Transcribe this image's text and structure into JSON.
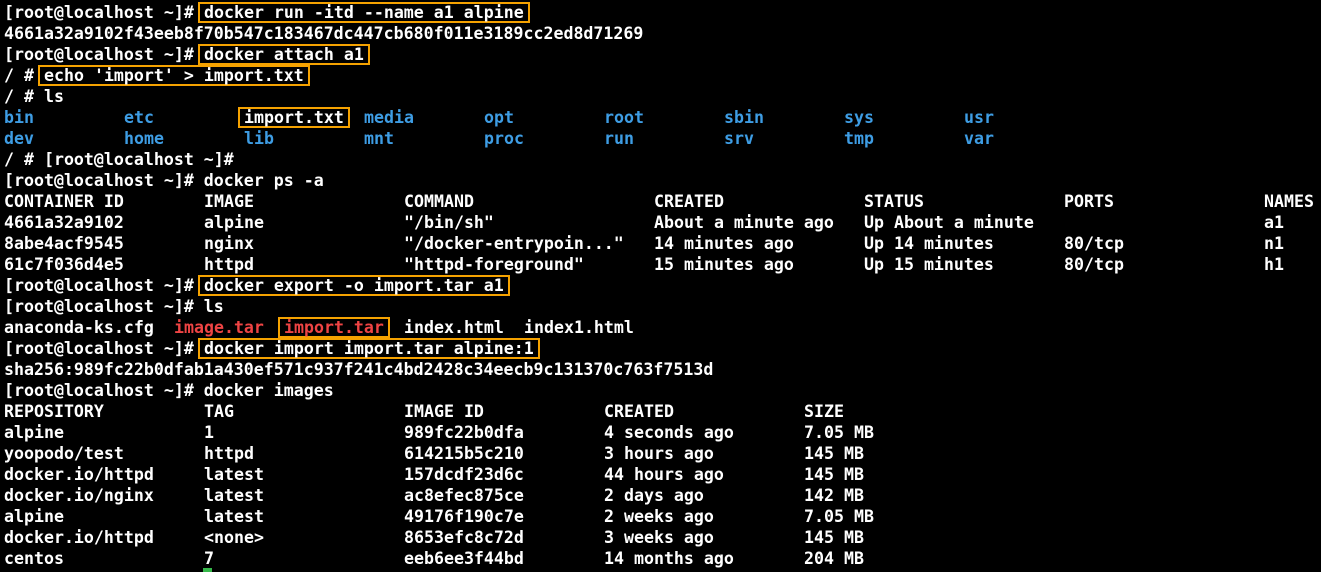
{
  "terminal": {
    "colors": {
      "background": "#000000",
      "text": "#ffffff",
      "directory": "#3e9de4",
      "archive": "#ef4444",
      "highlight_box": "#f5a200",
      "cursor": "#35b84a"
    },
    "lines": [
      {
        "name": "line-prompt-docker-run",
        "segs": [
          {
            "t": "[root@localhost ~]# ",
            "c": "w",
            "col": 0
          },
          {
            "t": "docker run -itd --name a1 alpine",
            "c": "w",
            "col": 20,
            "box": true
          }
        ]
      },
      {
        "name": "line-container-id-output",
        "segs": [
          {
            "t": "4661a32a9102f43eeb8f70b547c183467dc447cb680f011e3189cc2ed8d71269",
            "c": "w",
            "col": 0
          }
        ]
      },
      {
        "name": "line-prompt-docker-attach",
        "segs": [
          {
            "t": "[root@localhost ~]# ",
            "c": "w",
            "col": 0
          },
          {
            "t": "docker attach a1",
            "c": "w",
            "col": 20,
            "box": true
          }
        ]
      },
      {
        "name": "line-shell-echo",
        "segs": [
          {
            "t": "/ # ",
            "c": "w",
            "col": 0
          },
          {
            "t": "echo 'import' > import.txt",
            "c": "w",
            "col": 4,
            "box": true
          }
        ]
      },
      {
        "name": "line-shell-ls",
        "segs": [
          {
            "t": "/ # ls",
            "c": "w",
            "col": 0
          }
        ]
      },
      {
        "name": "line-ls-row-1",
        "segs": [
          {
            "t": "bin",
            "c": "b",
            "col": 0
          },
          {
            "t": "etc",
            "c": "b",
            "col": 12
          },
          {
            "t": "import.txt",
            "c": "w",
            "col": 24,
            "box": true
          },
          {
            "t": "media",
            "c": "b",
            "col": 36
          },
          {
            "t": "opt",
            "c": "b",
            "col": 48
          },
          {
            "t": "root",
            "c": "b",
            "col": 60
          },
          {
            "t": "sbin",
            "c": "b",
            "col": 72
          },
          {
            "t": "sys",
            "c": "b",
            "col": 84
          },
          {
            "t": "usr",
            "c": "b",
            "col": 96
          }
        ]
      },
      {
        "name": "line-ls-row-2",
        "segs": [
          {
            "t": "dev",
            "c": "b",
            "col": 0
          },
          {
            "t": "home",
            "c": "b",
            "col": 12
          },
          {
            "t": "lib",
            "c": "b",
            "col": 24
          },
          {
            "t": "mnt",
            "c": "b",
            "col": 36
          },
          {
            "t": "proc",
            "c": "b",
            "col": 48
          },
          {
            "t": "run",
            "c": "b",
            "col": 60
          },
          {
            "t": "srv",
            "c": "b",
            "col": 72
          },
          {
            "t": "tmp",
            "c": "b",
            "col": 84
          },
          {
            "t": "var",
            "c": "b",
            "col": 96
          }
        ]
      },
      {
        "name": "line-detach-prompt",
        "segs": [
          {
            "t": "/ # [root@localhost ~]#",
            "c": "w",
            "col": 0
          }
        ]
      },
      {
        "name": "line-prompt-docker-ps",
        "segs": [
          {
            "t": "[root@localhost ~]# docker ps -a",
            "c": "w",
            "col": 0
          }
        ]
      },
      {
        "name": "line-ps-header",
        "segs": [
          {
            "t": "CONTAINER ID",
            "c": "w",
            "col": 0
          },
          {
            "t": "IMAGE",
            "c": "w",
            "col": 20
          },
          {
            "t": "COMMAND",
            "c": "w",
            "col": 40
          },
          {
            "t": "CREATED",
            "c": "w",
            "col": 65
          },
          {
            "t": "STATUS",
            "c": "w",
            "col": 86
          },
          {
            "t": "PORTS",
            "c": "w",
            "col": 106
          },
          {
            "t": "NAMES",
            "c": "w",
            "col": 126
          }
        ]
      },
      {
        "name": "line-ps-row-a1",
        "segs": [
          {
            "t": "4661a32a9102",
            "c": "w",
            "col": 0
          },
          {
            "t": "alpine",
            "c": "w",
            "col": 20
          },
          {
            "t": "\"/bin/sh\"",
            "c": "w",
            "col": 40
          },
          {
            "t": "About a minute ago",
            "c": "w",
            "col": 65
          },
          {
            "t": "Up About a minute",
            "c": "w",
            "col": 86
          },
          {
            "t": "a1",
            "c": "w",
            "col": 126
          }
        ]
      },
      {
        "name": "line-ps-row-n1",
        "segs": [
          {
            "t": "8abe4acf9545",
            "c": "w",
            "col": 0
          },
          {
            "t": "nginx",
            "c": "w",
            "col": 20
          },
          {
            "t": "\"/docker-entrypoin...\"",
            "c": "w",
            "col": 40
          },
          {
            "t": "14 minutes ago",
            "c": "w",
            "col": 65
          },
          {
            "t": "Up 14 minutes",
            "c": "w",
            "col": 86
          },
          {
            "t": "80/tcp",
            "c": "w",
            "col": 106
          },
          {
            "t": "n1",
            "c": "w",
            "col": 126
          }
        ]
      },
      {
        "name": "line-ps-row-h1",
        "segs": [
          {
            "t": "61c7f036d4e5",
            "c": "w",
            "col": 0
          },
          {
            "t": "httpd",
            "c": "w",
            "col": 20
          },
          {
            "t": "\"httpd-foreground\"",
            "c": "w",
            "col": 40
          },
          {
            "t": "15 minutes ago",
            "c": "w",
            "col": 65
          },
          {
            "t": "Up 15 minutes",
            "c": "w",
            "col": 86
          },
          {
            "t": "80/tcp",
            "c": "w",
            "col": 106
          },
          {
            "t": "h1",
            "c": "w",
            "col": 126
          }
        ]
      },
      {
        "name": "line-prompt-docker-export",
        "segs": [
          {
            "t": "[root@localhost ~]# ",
            "c": "w",
            "col": 0
          },
          {
            "t": "docker export -o import.tar a1",
            "c": "w",
            "col": 20,
            "box": true
          }
        ]
      },
      {
        "name": "line-prompt-ls",
        "segs": [
          {
            "t": "[root@localhost ~]# ls",
            "c": "w",
            "col": 0
          }
        ]
      },
      {
        "name": "line-ls-files",
        "segs": [
          {
            "t": "anaconda-ks.cfg",
            "c": "w",
            "col": 0
          },
          {
            "t": "image.tar",
            "c": "r",
            "col": 17
          },
          {
            "t": "import.tar",
            "c": "r",
            "col": 28,
            "box": true
          },
          {
            "t": "index.html",
            "c": "w",
            "col": 40
          },
          {
            "t": "index1.html",
            "c": "w",
            "col": 52
          }
        ]
      },
      {
        "name": "line-prompt-docker-import",
        "segs": [
          {
            "t": "[root@localhost ~]#",
            "c": "w",
            "col": 0
          },
          {
            "t": "docker import import.tar alpine:1",
            "c": "w",
            "col": 20,
            "box": true
          }
        ]
      },
      {
        "name": "line-import-digest",
        "segs": [
          {
            "t": "sha256:989fc22b0dfab1a430ef571c937f241c4bd2428c34eecb9c131370c763f7513d",
            "c": "w",
            "col": 0
          }
        ]
      },
      {
        "name": "line-prompt-docker-images",
        "segs": [
          {
            "t": "[root@localhost ~]# docker images",
            "c": "w",
            "col": 0
          }
        ]
      },
      {
        "name": "line-images-header",
        "segs": [
          {
            "t": "REPOSITORY",
            "c": "w",
            "col": 0
          },
          {
            "t": "TAG",
            "c": "w",
            "col": 20
          },
          {
            "t": "IMAGE ID",
            "c": "w",
            "col": 40
          },
          {
            "t": "CREATED",
            "c": "w",
            "col": 60
          },
          {
            "t": "SIZE",
            "c": "w",
            "col": 80
          }
        ]
      },
      {
        "name": "line-images-row-alpine-1",
        "segs": [
          {
            "t": "alpine",
            "c": "w",
            "col": 0
          },
          {
            "t": "1",
            "c": "w",
            "col": 20
          },
          {
            "t": "989fc22b0dfa",
            "c": "w",
            "col": 40
          },
          {
            "t": "4 seconds ago",
            "c": "w",
            "col": 60
          },
          {
            "t": "7.05 MB",
            "c": "w",
            "col": 80
          }
        ]
      },
      {
        "name": "line-images-row-yoopodo-test",
        "segs": [
          {
            "t": "yoopodo/test",
            "c": "w",
            "col": 0
          },
          {
            "t": "httpd",
            "c": "w",
            "col": 20
          },
          {
            "t": "614215b5c210",
            "c": "w",
            "col": 40
          },
          {
            "t": "3 hours ago",
            "c": "w",
            "col": 60
          },
          {
            "t": "145 MB",
            "c": "w",
            "col": 80
          }
        ]
      },
      {
        "name": "line-images-row-httpd",
        "segs": [
          {
            "t": "docker.io/httpd",
            "c": "w",
            "col": 0
          },
          {
            "t": "latest",
            "c": "w",
            "col": 20
          },
          {
            "t": "157dcdf23d6c",
            "c": "w",
            "col": 40
          },
          {
            "t": "44 hours ago",
            "c": "w",
            "col": 60
          },
          {
            "t": "145 MB",
            "c": "w",
            "col": 80
          }
        ]
      },
      {
        "name": "line-images-row-nginx",
        "segs": [
          {
            "t": "docker.io/nginx",
            "c": "w",
            "col": 0
          },
          {
            "t": "latest",
            "c": "w",
            "col": 20
          },
          {
            "t": "ac8efec875ce",
            "c": "w",
            "col": 40
          },
          {
            "t": "2 days ago",
            "c": "w",
            "col": 60
          },
          {
            "t": "142 MB",
            "c": "w",
            "col": 80
          }
        ]
      },
      {
        "name": "line-images-row-alpine-latest",
        "segs": [
          {
            "t": "alpine",
            "c": "w",
            "col": 0
          },
          {
            "t": "latest",
            "c": "w",
            "col": 20
          },
          {
            "t": "49176f190c7e",
            "c": "w",
            "col": 40
          },
          {
            "t": "2 weeks ago",
            "c": "w",
            "col": 60
          },
          {
            "t": "7.05 MB",
            "c": "w",
            "col": 80
          }
        ]
      },
      {
        "name": "line-images-row-httpd-none",
        "segs": [
          {
            "t": "docker.io/httpd",
            "c": "w",
            "col": 0
          },
          {
            "t": "<none>",
            "c": "w",
            "col": 20
          },
          {
            "t": "8653efc8c72d",
            "c": "w",
            "col": 40
          },
          {
            "t": "3 weeks ago",
            "c": "w",
            "col": 60
          },
          {
            "t": "145 MB",
            "c": "w",
            "col": 80
          }
        ]
      },
      {
        "name": "line-images-row-centos",
        "segs": [
          {
            "t": "centos",
            "c": "w",
            "col": 0
          },
          {
            "t": "7",
            "c": "w",
            "col": 20
          },
          {
            "t": "eeb6ee3f44bd",
            "c": "w",
            "col": 40
          },
          {
            "t": "14 months ago",
            "c": "w",
            "col": 60
          },
          {
            "t": "204 MB",
            "c": "w",
            "col": 80
          }
        ]
      }
    ]
  }
}
